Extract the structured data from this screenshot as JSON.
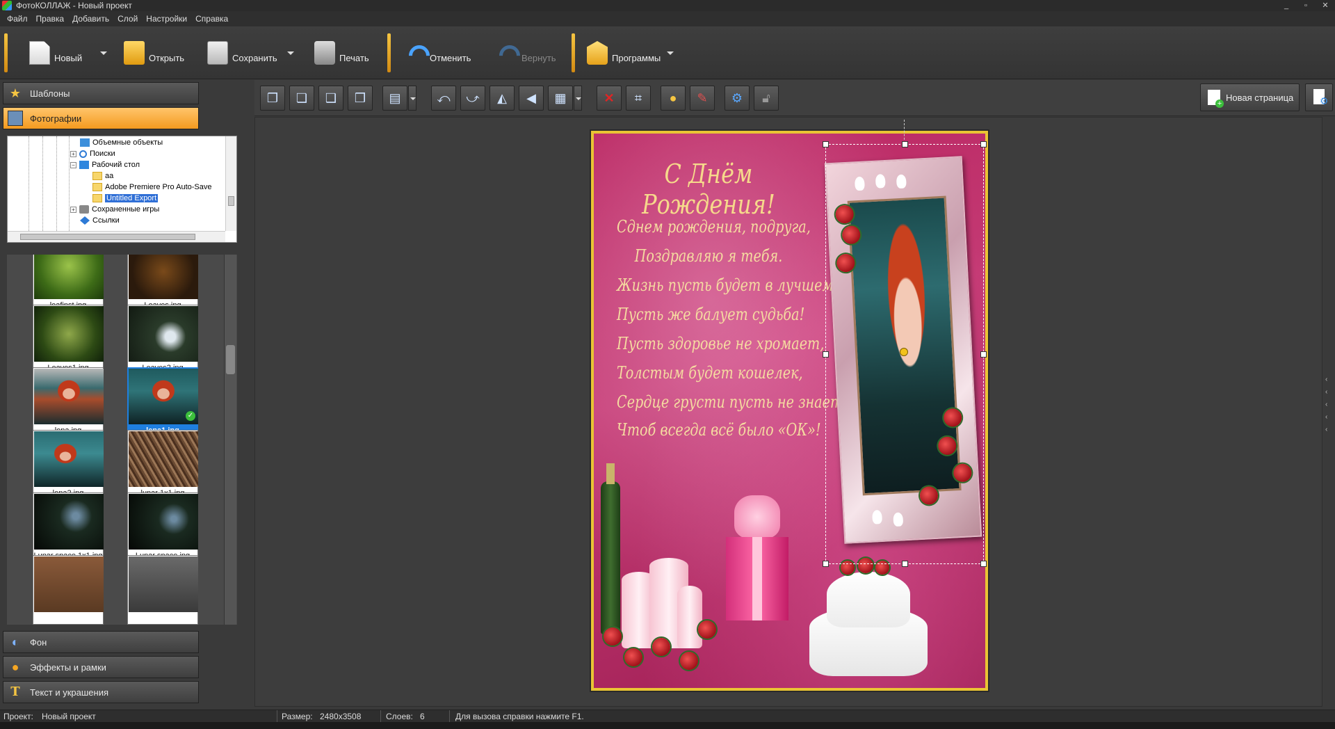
{
  "window": {
    "title": "ФотоКОЛЛАЖ - Новый проект",
    "controls": [
      "_",
      "▫",
      "✕"
    ]
  },
  "menu": [
    "Файл",
    "Правка",
    "Добавить",
    "Слой",
    "Настройки",
    "Справка"
  ],
  "toolbar": {
    "new_label": "Новый",
    "open_label": "Открыть",
    "save_label": "Сохранить",
    "print_label": "Печать",
    "undo_label": "Отменить",
    "redo_label": "Вернуть",
    "programs_label": "Программы",
    "accent_color": "#f5c542"
  },
  "sidebar": {
    "templates_label": "Шаблоны",
    "photos_label": "Фотографии",
    "background_label": "Фон",
    "effects_label": "Эффекты и рамки",
    "text_label": "Текст и украшения",
    "active_color": "#f7a93a"
  },
  "tree": {
    "items": [
      {
        "label": "Объемные объекты",
        "icon": "3d-objects-icon"
      },
      {
        "label": "Поиски",
        "icon": "search-icon"
      },
      {
        "label": "Рабочий стол",
        "icon": "desktop-icon"
      },
      {
        "label": "aa",
        "icon": "folder-icon"
      },
      {
        "label": "Adobe Premiere Pro Auto-Save",
        "icon": "folder-icon"
      },
      {
        "label": "Untitled Export",
        "icon": "folder-icon",
        "selected": true
      },
      {
        "label": "Сохраненные игры",
        "icon": "saved-games-icon"
      },
      {
        "label": "Ссылки",
        "icon": "links-icon"
      }
    ]
  },
  "thumbnails": [
    {
      "name": "leafinst.jpg"
    },
    {
      "name": "Leaves.jpg"
    },
    {
      "name": "Leaves1.jpg"
    },
    {
      "name": "Leaves2.jpg"
    },
    {
      "name": "lena.jpg"
    },
    {
      "name": "lena1.jpg",
      "selected": true
    },
    {
      "name": "lena2.jpg"
    },
    {
      "name": "lunar 1x1.jpg"
    },
    {
      "name": "Lunar space 1x1.jpg"
    },
    {
      "name": "Lunar space.jpg"
    }
  ],
  "edit_toolbar": {
    "new_page_label": "Новая страница"
  },
  "card": {
    "title": "С Днём Рождения!",
    "poem": [
      "Сднем рождения, подруга,",
      "Поздравляю я тебя.",
      "Жизнь пусть будет в лучшем виде,",
      "Пусть же балует судьба!",
      "Пусть здоровье не хромает,",
      "Толстым будет кошелек,",
      "Сердце грусти пусть не знает,",
      "Чтоб всегда всё было «ОК»!"
    ],
    "border_color": "#e9c434",
    "text_color": "#f5dba0"
  },
  "status": {
    "project_label": "Проект:",
    "project_value": "Новый проект",
    "size_label": "Размер:",
    "size_value": "2480x3508",
    "layers_label": "Слоев:",
    "layers_value": "6",
    "help_text": "Для вызова справки нажмите F1."
  }
}
